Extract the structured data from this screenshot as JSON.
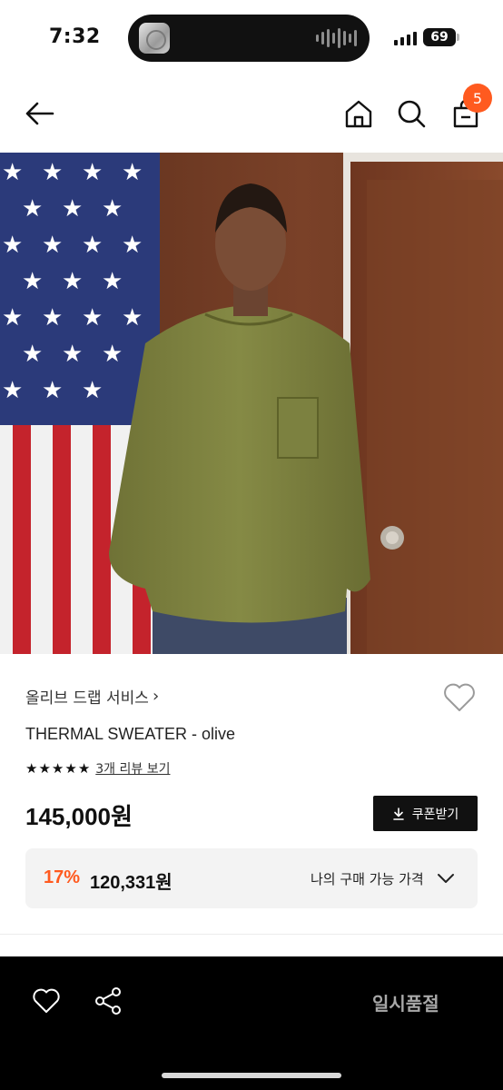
{
  "status_bar": {
    "time": "7:32",
    "battery": "69"
  },
  "nav": {
    "back_icon": "arrow-left-icon",
    "home_icon": "home-icon",
    "search_icon": "search-icon",
    "cart_icon": "shopping-bag-icon",
    "cart_badge": "5"
  },
  "product": {
    "image_description_icon": "product-photo",
    "brand": "올리브 드랩 서비스",
    "name": "THERMAL SWEATER - olive",
    "rating_stars": 5,
    "review_link": "3개 리뷰 보기",
    "price": "145,000원",
    "coupon_button": "쿠폰받기",
    "discount": {
      "percent": "17%",
      "price": "120,331원",
      "label": "나의 구매 가능 가격"
    }
  },
  "bottom_bar": {
    "status": "일시품절"
  },
  "colors": {
    "accent": "#ff5a1f",
    "bottom_bar": "#000000",
    "discount_box": "#f3f3f3"
  }
}
